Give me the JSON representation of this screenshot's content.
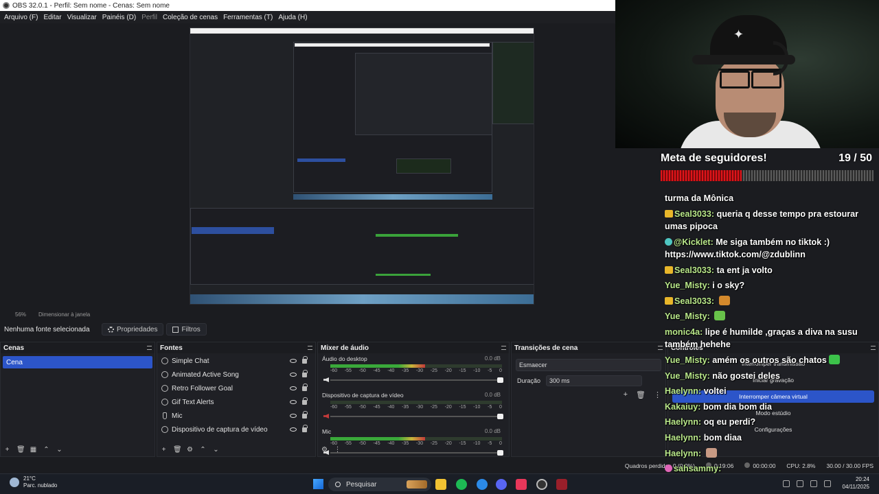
{
  "window": {
    "title": "OBS 32.0.1 - Perfil: Sem nome - Cenas: Sem nome"
  },
  "menu": [
    {
      "label": "Arquivo (F)",
      "enabled": true
    },
    {
      "label": "Editar",
      "enabled": true
    },
    {
      "label": "Visualizar",
      "enabled": true
    },
    {
      "label": "Painéis (D)",
      "enabled": true
    },
    {
      "label": "Perfil",
      "enabled": false
    },
    {
      "label": "Coleção de cenas",
      "enabled": true
    },
    {
      "label": "Ferramentas (T)",
      "enabled": true
    },
    {
      "label": "Ajuda (H)",
      "enabled": true
    }
  ],
  "preview_status": {
    "zoom": "56%",
    "resize_mode": "Dimensionar à janela"
  },
  "properties_bar": {
    "no_source": "Nenhuma fonte selecionada",
    "properties_btn": "Propriedades",
    "filters_btn": "Filtros"
  },
  "scenes": {
    "title": "Cenas",
    "items": [
      {
        "label": "Cena",
        "selected": true
      }
    ]
  },
  "sources": {
    "title": "Fontes",
    "items": [
      {
        "label": "Simple Chat",
        "icon": "globe-icon"
      },
      {
        "label": "Animated Active Song",
        "icon": "globe-icon"
      },
      {
        "label": "Retro Follower Goal",
        "icon": "globe-icon"
      },
      {
        "label": "Gif Text Alerts",
        "icon": "globe-icon"
      },
      {
        "label": "Mic",
        "icon": "mic-icon"
      },
      {
        "label": "Dispositivo de captura de vídeo",
        "icon": "camera-icon"
      }
    ]
  },
  "mixer": {
    "title": "Mixer de áudio",
    "ticks": [
      "-60",
      "-55",
      "-50",
      "-45",
      "-40",
      "-35",
      "-30",
      "-25",
      "-20",
      "-15",
      "-10",
      "-5",
      "0"
    ],
    "channels": [
      {
        "name": "Áudio do desktop",
        "db": "0.0 dB",
        "level": 0.55,
        "muted": false
      },
      {
        "name": "Dispositivo de captura de vídeo",
        "db": "0.0 dB",
        "level": 0.0,
        "muted": true
      },
      {
        "name": "Mic",
        "db": "0.0 dB",
        "level": 0.55,
        "muted": false
      }
    ]
  },
  "transitions": {
    "title": "Transições de cena",
    "selected": "Esmaecer",
    "duration_label": "Duração",
    "duration_value": "300 ms"
  },
  "controls": {
    "title": "Controles",
    "buttons": [
      {
        "label": "Interromper transmissão",
        "active": false
      },
      {
        "label": "Iniciar gravação",
        "active": false
      },
      {
        "label": "Interromper câmera virtual",
        "active": true
      },
      {
        "label": "Modo estúdio",
        "active": false
      },
      {
        "label": "Configurações",
        "active": false
      }
    ]
  },
  "statusbar": {
    "dropped": "Quadros perdidos 0 (0.0%)",
    "live_time": "0:19:06",
    "rec_time": "00:00:00",
    "cpu": "CPU: 2.8%",
    "fps": "30.00 / 30.00 FPS"
  },
  "overlay": {
    "goal_title": "Meta de seguidores!",
    "goal_count": "19 / 50",
    "goal_progress": 0.38
  },
  "chat": [
    {
      "user": "",
      "text": "turma da Mônica",
      "badge": "",
      "wrap": false
    },
    {
      "user": "Seal3033:",
      "text": "queria q desse tempo pra estourar umas pipoca",
      "badge": "gold",
      "wrap": true
    },
    {
      "user": "@Kicklet:",
      "text": "Me siga também no tiktok :) https://www.tiktok.com/@zdublinn",
      "badge": "teal",
      "wrap": true
    },
    {
      "user": "Seal3033:",
      "text": "ta ent ja volto",
      "badge": "gold",
      "wrap": false
    },
    {
      "user": "Yue_Misty:",
      "text": "i o sky?",
      "badge": "",
      "wrap": false
    },
    {
      "user": "Seal3033:",
      "text": "",
      "badge": "gold",
      "emote": "#d4892c",
      "wrap": false
    },
    {
      "user": "Yue_Misty:",
      "text": "",
      "badge": "",
      "emote": "#68c24a",
      "wrap": false
    },
    {
      "user": "monic4a:",
      "text": "lipe é humilde ,graças a diva na susu também hehehe",
      "badge": "",
      "wrap": true
    },
    {
      "user": "Yue_Misty:",
      "text": "amém os outros são chatos",
      "badge": "",
      "emote": "#3cc24a",
      "wrap": false
    },
    {
      "user": "Yue_Misty:",
      "text": "não gostei deles",
      "badge": "",
      "wrap": false
    },
    {
      "user": "Haelynn:",
      "text": "voltei",
      "badge": "",
      "wrap": false
    },
    {
      "user": "Kakaiuy:",
      "text": "bom dia bom dia",
      "badge": "",
      "wrap": false
    },
    {
      "user": "Haelynn:",
      "text": "oq eu perdi?",
      "badge": "",
      "wrap": false
    },
    {
      "user": "Haelynn:",
      "text": "bom diaa",
      "badge": "",
      "wrap": false
    },
    {
      "user": "Haelynn:",
      "text": "",
      "badge": "",
      "emote": "#c89a84",
      "wrap": false
    },
    {
      "user": "sahsammy:",
      "text": "",
      "badge": "pink",
      "wrap": false
    }
  ],
  "taskbar": {
    "weather_temp": "21°C",
    "weather_desc": "Parc. nublado",
    "search_placeholder": "Pesquisar",
    "time": "20:24",
    "date": "04/11/2025"
  },
  "colors": {
    "accent": "#2c55c9",
    "chat_user": "#b9e88a",
    "goal_fill": "#e0141a",
    "meter_green": "#3aa83a",
    "meter_red": "#c23a3a"
  }
}
